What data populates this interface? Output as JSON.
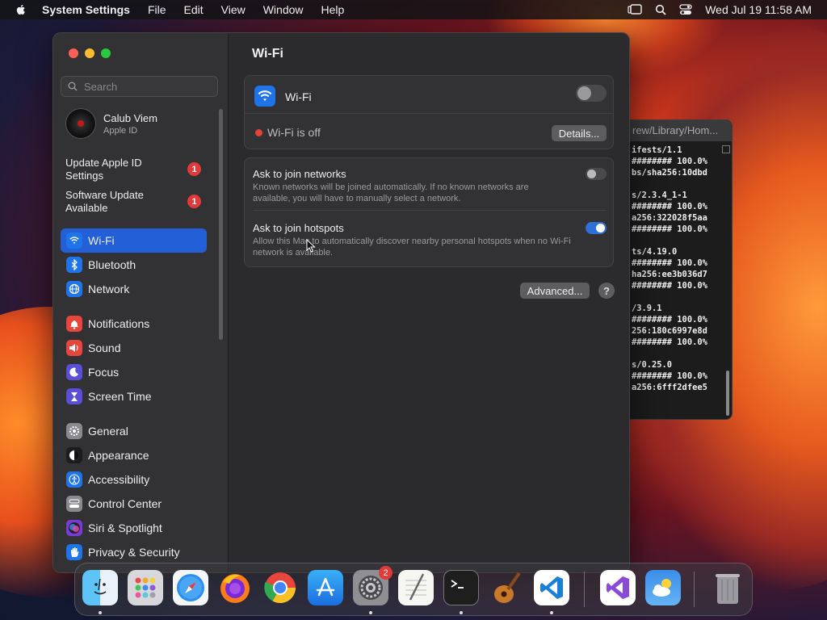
{
  "menubar": {
    "app_name": "System Settings",
    "items": [
      "File",
      "Edit",
      "View",
      "Window",
      "Help"
    ],
    "clock": "Wed Jul 19  11:58 AM"
  },
  "sidebar": {
    "search_placeholder": "Search",
    "user": {
      "name": "Calub Viem",
      "subtitle": "Apple ID"
    },
    "updates": [
      {
        "label": "Update Apple ID Settings",
        "badge": "1"
      },
      {
        "label": "Software Update Available",
        "badge": "1"
      }
    ],
    "items": [
      {
        "label": "Wi-Fi",
        "icon": "wifi-icon",
        "color": "#1e74e8",
        "selected": true
      },
      {
        "label": "Bluetooth",
        "icon": "bluetooth-icon",
        "color": "#1e74e8"
      },
      {
        "label": "Network",
        "icon": "globe-icon",
        "color": "#1e74e8"
      },
      {
        "label": "Notifications",
        "icon": "bell-icon",
        "color": "#e8453c"
      },
      {
        "label": "Sound",
        "icon": "speaker-icon",
        "color": "#e8453c"
      },
      {
        "label": "Focus",
        "icon": "moon-icon",
        "color": "#5b4fd8"
      },
      {
        "label": "Screen Time",
        "icon": "hourglass-icon",
        "color": "#5b4fd8"
      },
      {
        "label": "General",
        "icon": "gear-icon",
        "color": "#8a8a8e"
      },
      {
        "label": "Appearance",
        "icon": "appearance-icon",
        "color": "#1c1c1e"
      },
      {
        "label": "Accessibility",
        "icon": "accessibility-icon",
        "color": "#1e74e8"
      },
      {
        "label": "Control Center",
        "icon": "control-center-icon",
        "color": "#8a8a8e"
      },
      {
        "label": "Siri & Spotlight",
        "icon": "siri-icon",
        "color": "#7a3ad8"
      },
      {
        "label": "Privacy & Security",
        "icon": "hand-icon",
        "color": "#1e74e8"
      }
    ]
  },
  "main": {
    "title": "Wi-Fi",
    "wifi_label": "Wi-Fi",
    "wifi_status": "Wi-Fi is off",
    "details_label": "Details...",
    "ask_networks": {
      "title": "Ask to join networks",
      "desc": "Known networks will be joined automatically. If no known networks are available, you will have to manually select a network."
    },
    "ask_hotspots": {
      "title": "Ask to join hotspots",
      "desc": "Allow this Mac to automatically discover nearby personal hotspots when no Wi-Fi network is available."
    },
    "advanced_label": "Advanced...",
    "help_label": "?"
  },
  "terminal": {
    "title": "rew/Library/Hom...",
    "lines": [
      "ifests/1.1",
      "######## 100.0%",
      "bs/sha256:10dbd",
      "",
      "s/2.3.4_1-1",
      "######## 100.0%",
      "a256:322028f5aa",
      "######## 100.0%",
      "",
      "ts/4.19.0",
      "######## 100.0%",
      "ha256:ee3b036d7",
      "######## 100.0%",
      "",
      "/3.9.1",
      "######## 100.0%",
      "256:180c6997e8d",
      "######## 100.0%",
      "",
      "s/0.25.0",
      "######## 100.0%",
      "a256:6fff2dfee5"
    ]
  },
  "dock": {
    "settings_badge": "2",
    "apps": [
      "Finder",
      "Launchpad",
      "Safari",
      "Firefox",
      "Chrome",
      "App Store",
      "System Settings",
      "TextEdit",
      "Terminal",
      "GarageBand",
      "Visual Studio Code",
      "Visual Studio",
      "Weather",
      "Trash"
    ]
  }
}
